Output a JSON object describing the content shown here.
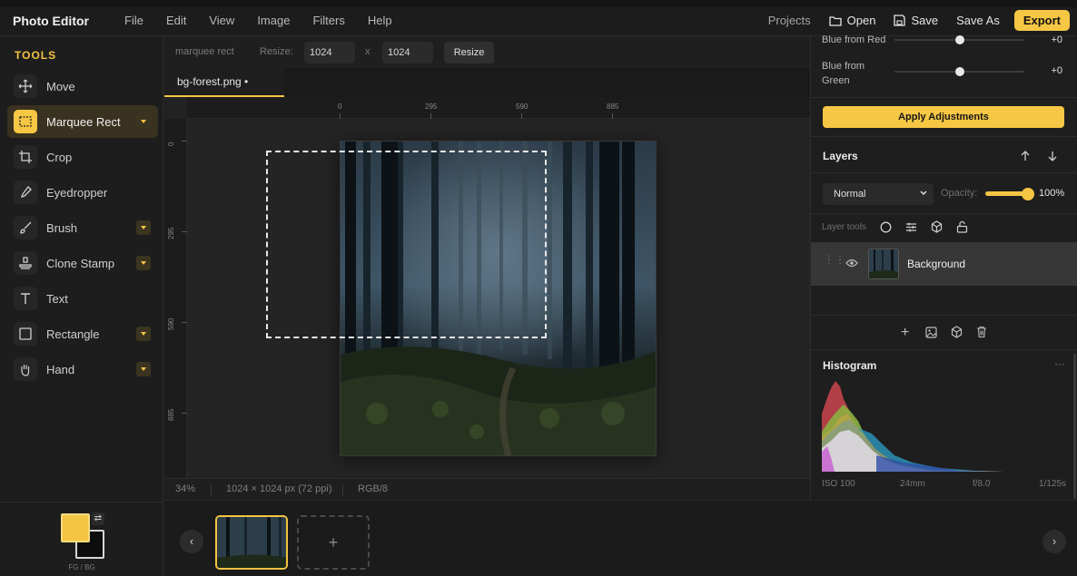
{
  "app": {
    "title": "Photo Editor"
  },
  "menu": [
    "File",
    "Edit",
    "View",
    "Image",
    "Filters",
    "Help"
  ],
  "topright": {
    "projects": "Projects",
    "open": "Open",
    "save": "Save",
    "save_as": "Save As",
    "export": "Export"
  },
  "tools": {
    "title": "TOOLS",
    "items": [
      {
        "label": "Move",
        "icon": "move-icon",
        "caret": false,
        "active": false
      },
      {
        "label": "Marquee Rect",
        "icon": "marquee-rect-icon",
        "caret": true,
        "active": true
      },
      {
        "label": "Crop",
        "icon": "crop-icon",
        "caret": false,
        "active": false
      },
      {
        "label": "Eyedropper",
        "icon": "eyedropper-icon",
        "caret": false,
        "active": false
      },
      {
        "label": "Brush",
        "icon": "brush-icon",
        "caret": true,
        "active": false
      },
      {
        "label": "Clone Stamp",
        "icon": "clone-stamp-icon",
        "caret": true,
        "active": false
      },
      {
        "label": "Text",
        "icon": "text-icon",
        "caret": false,
        "active": false
      },
      {
        "label": "Rectangle",
        "icon": "rectangle-icon",
        "caret": true,
        "active": false
      },
      {
        "label": "Hand",
        "icon": "hand-icon",
        "caret": true,
        "active": false
      }
    ]
  },
  "colors": {
    "label": "FG / BG",
    "swap": "⇄",
    "fg": "#f4c443",
    "bg": "#0d0d0d"
  },
  "options": {
    "tool": "marquee rect",
    "resize_label": "Resize:",
    "width": "1024",
    "x": "x",
    "height": "1024",
    "resize_button": "Resize"
  },
  "doc_tab": {
    "label": "bg-forest.png •"
  },
  "rulers": {
    "h": [
      "0",
      "295",
      "590",
      "885"
    ],
    "v": [
      "0",
      "295",
      "590",
      "885"
    ]
  },
  "status": {
    "zoom": "34%",
    "size": "1024 × 1024 px (72 ppi)",
    "mode": "RGB/8"
  },
  "filmstrip": {
    "prev": "‹",
    "next": "›",
    "add": "+"
  },
  "adjustments": {
    "rows": [
      {
        "label": "Blue from Red",
        "value": "+0"
      },
      {
        "label": "Blue from Green",
        "value": "+0"
      }
    ],
    "apply": "Apply Adjustments"
  },
  "layers": {
    "title": "Layers",
    "blend": "Normal",
    "opacity_label": "Opacity:",
    "opacity": "100%",
    "opacity_value": 1.0,
    "tools_label": "Layer tools",
    "items": [
      {
        "name": "Background"
      }
    ]
  },
  "histogram": {
    "title": "Histogram",
    "more": "···",
    "exif": [
      "ISO 100",
      "24mm",
      "f/8.0",
      "1/125s"
    ]
  },
  "accent": "#f4c443"
}
